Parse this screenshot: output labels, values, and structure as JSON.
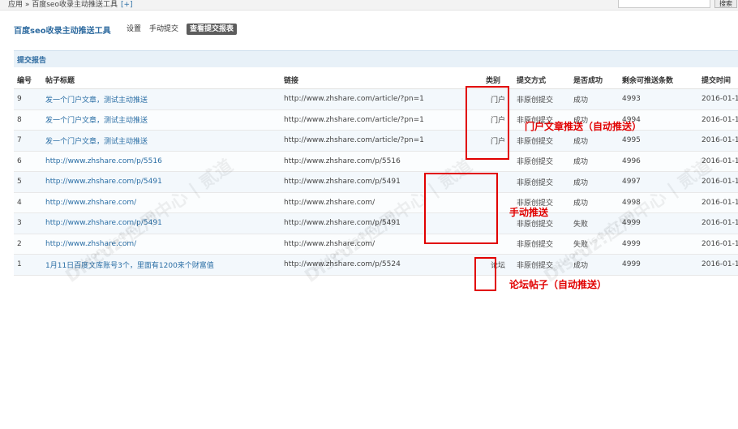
{
  "breadcrumb": {
    "text": "应用 » 百度seo收录主动推送工具",
    "plus": "[+]"
  },
  "search": {
    "value": "",
    "button": "搜索"
  },
  "plugin": {
    "title": "百度seo收录主动推送工具",
    "nav": [
      "设置",
      "手动提交",
      "查看提交报表"
    ]
  },
  "section": {
    "title": "提交报告"
  },
  "table": {
    "headers": [
      "编号",
      "帖子标题",
      "链接",
      "类别",
      "提交方式",
      "是否成功",
      "剩余可推送条数",
      "提交时间"
    ],
    "rows": [
      {
        "id": "9",
        "title": "发一个门户文章，测试主动推送",
        "link": "http://www.zhshare.com/article/?pn=1",
        "cat": "门户",
        "method": "非原创提交",
        "status": "成功",
        "remain": "4993",
        "time": "2016-01-1"
      },
      {
        "id": "8",
        "title": "发一个门户文章，测试主动推送",
        "link": "http://www.zhshare.com/article/?pn=1",
        "cat": "门户",
        "method": "非原创提交",
        "status": "成功",
        "remain": "4994",
        "time": "2016-01-1"
      },
      {
        "id": "7",
        "title": "发一个门户文章，测试主动推送",
        "link": "http://www.zhshare.com/article/?pn=1",
        "cat": "门户",
        "method": "非原创提交",
        "status": "成功",
        "remain": "4995",
        "time": "2016-01-1"
      },
      {
        "id": "6",
        "title": "http://www.zhshare.com/p/5516",
        "link": "http://www.zhshare.com/p/5516",
        "cat": "",
        "method": "非原创提交",
        "status": "成功",
        "remain": "4996",
        "time": "2016-01-1"
      },
      {
        "id": "5",
        "title": "http://www.zhshare.com/p/5491",
        "link": "http://www.zhshare.com/p/5491",
        "cat": "",
        "method": "非原创提交",
        "status": "成功",
        "remain": "4997",
        "time": "2016-01-1"
      },
      {
        "id": "4",
        "title": "http://www.zhshare.com/",
        "link": "http://www.zhshare.com/",
        "cat": "",
        "method": "非原创提交",
        "status": "成功",
        "remain": "4998",
        "time": "2016-01-1"
      },
      {
        "id": "3",
        "title": "http://www.zhshare.com/p/5491",
        "link": "http://www.zhshare.com/p/5491",
        "cat": "",
        "method": "非原创提交",
        "status": "失败",
        "remain": "4999",
        "time": "2016-01-1"
      },
      {
        "id": "2",
        "title": "http://www.zhshare.com/",
        "link": "http://www.zhshare.com/",
        "cat": "",
        "method": "非原创提交",
        "status": "失败",
        "remain": "4999",
        "time": "2016-01-1"
      },
      {
        "id": "1",
        "title": "1月11日百度文库账号3个，里面有1200来个财富值",
        "link": "http://www.zhshare.com/p/5524",
        "cat": "论坛",
        "method": "非原创提交",
        "status": "成功",
        "remain": "4999",
        "time": "2016-01-1"
      }
    ]
  },
  "annotations": {
    "portal": "门户文章推送（自动推送）",
    "manual": "手动推送",
    "forum": "论坛帖子（自动推送）"
  },
  "watermark": {
    "text": "Discuz!应用中心 | 贰道",
    "sub": "addon.discuz.com"
  },
  "colors": {
    "link": "#2a6ea5",
    "accent": "#e10000",
    "header_bg": "#e8f1f8"
  }
}
